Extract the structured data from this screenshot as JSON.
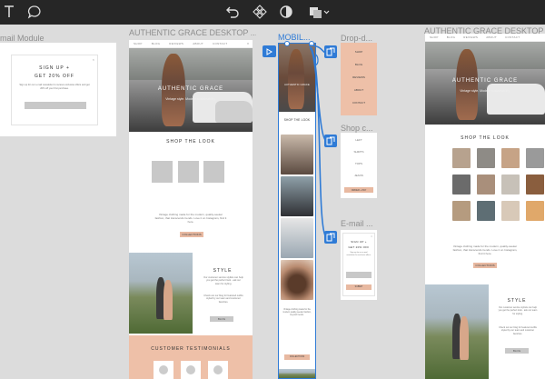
{
  "toolbar": {
    "icons": [
      "text-tool-icon",
      "comment-icon",
      "undo-icon",
      "component-icon",
      "mask-icon",
      "layers-icon",
      "chevron-down-icon"
    ]
  },
  "labels": {
    "email_module": "mail Module",
    "desktop": "AUTHENTIC GRACE DESKTOP ...",
    "mobile": "MOBIL...",
    "dropdown": "Drop-d...",
    "shop_card": "Shop c...",
    "email_mobile": "E-mail ...",
    "desktop_right": "AUTHENTIC GRACE DESKTOP ..."
  },
  "email_module": {
    "line1": "SIGN UP +",
    "line2": "GET 20% OFF",
    "body": "Sign up for our e-mail newsletter to receive exclusive offers and get 20% off your first purchase."
  },
  "nav_items": [
    "SHOP",
    "BLOG",
    "REVIEWS",
    "ABOUT",
    "CONTACT"
  ],
  "hero": {
    "title": "AUTHENTIC GRACE",
    "tagline": "Vintage style. Modern sustainability."
  },
  "shop_section": {
    "title": "SHOP THE LOOK"
  },
  "vintage_section": {
    "text": "Vintage clothing made for the modern, quality-seeker fashion, that transcends trends. Love it on Instagram, find it here.",
    "button": "COLLECTIONS"
  },
  "style_section": {
    "title": "STYLE",
    "text": "Our customer service stylists can help you get the perfect look - ask our team for styling.",
    "text2": "Check out our blog for featured outfits styled by our team and customer favorites.",
    "button": "BLOG"
  },
  "testimonials": {
    "title": "CUSTOMER TESTIMONIALS"
  },
  "mobile": {
    "title": "AUTHENTIC GRACE",
    "shop_title": "SHOP THE LOOK",
    "vintage_text": "Vintage clothing made for the modern quality-seeker fashion, beyond trends.",
    "button": "COLLECTIONS",
    "style_text": "Our customer service stylists can help you get the perfect look."
  },
  "dropdown": {
    "items": [
      "SHOP",
      "BLOG",
      "REVIEWS",
      "ABOUT",
      "CONTACT"
    ]
  },
  "shop_card": {
    "items": [
      "LEFT",
      "SHIRTS",
      "TOPS",
      "JEANS"
    ],
    "button": "ORDER + PAY"
  },
  "email_mobile": {
    "line1": "SIGN UP +",
    "line2": "GET 20% OFF",
    "body": "Sign up for our e-mail newsletter for exclusive offers.",
    "button": "SUBMIT"
  },
  "colors": {
    "accent": "#2f7bd6",
    "peach": "#eec0a8",
    "toolbar": "#262626"
  }
}
